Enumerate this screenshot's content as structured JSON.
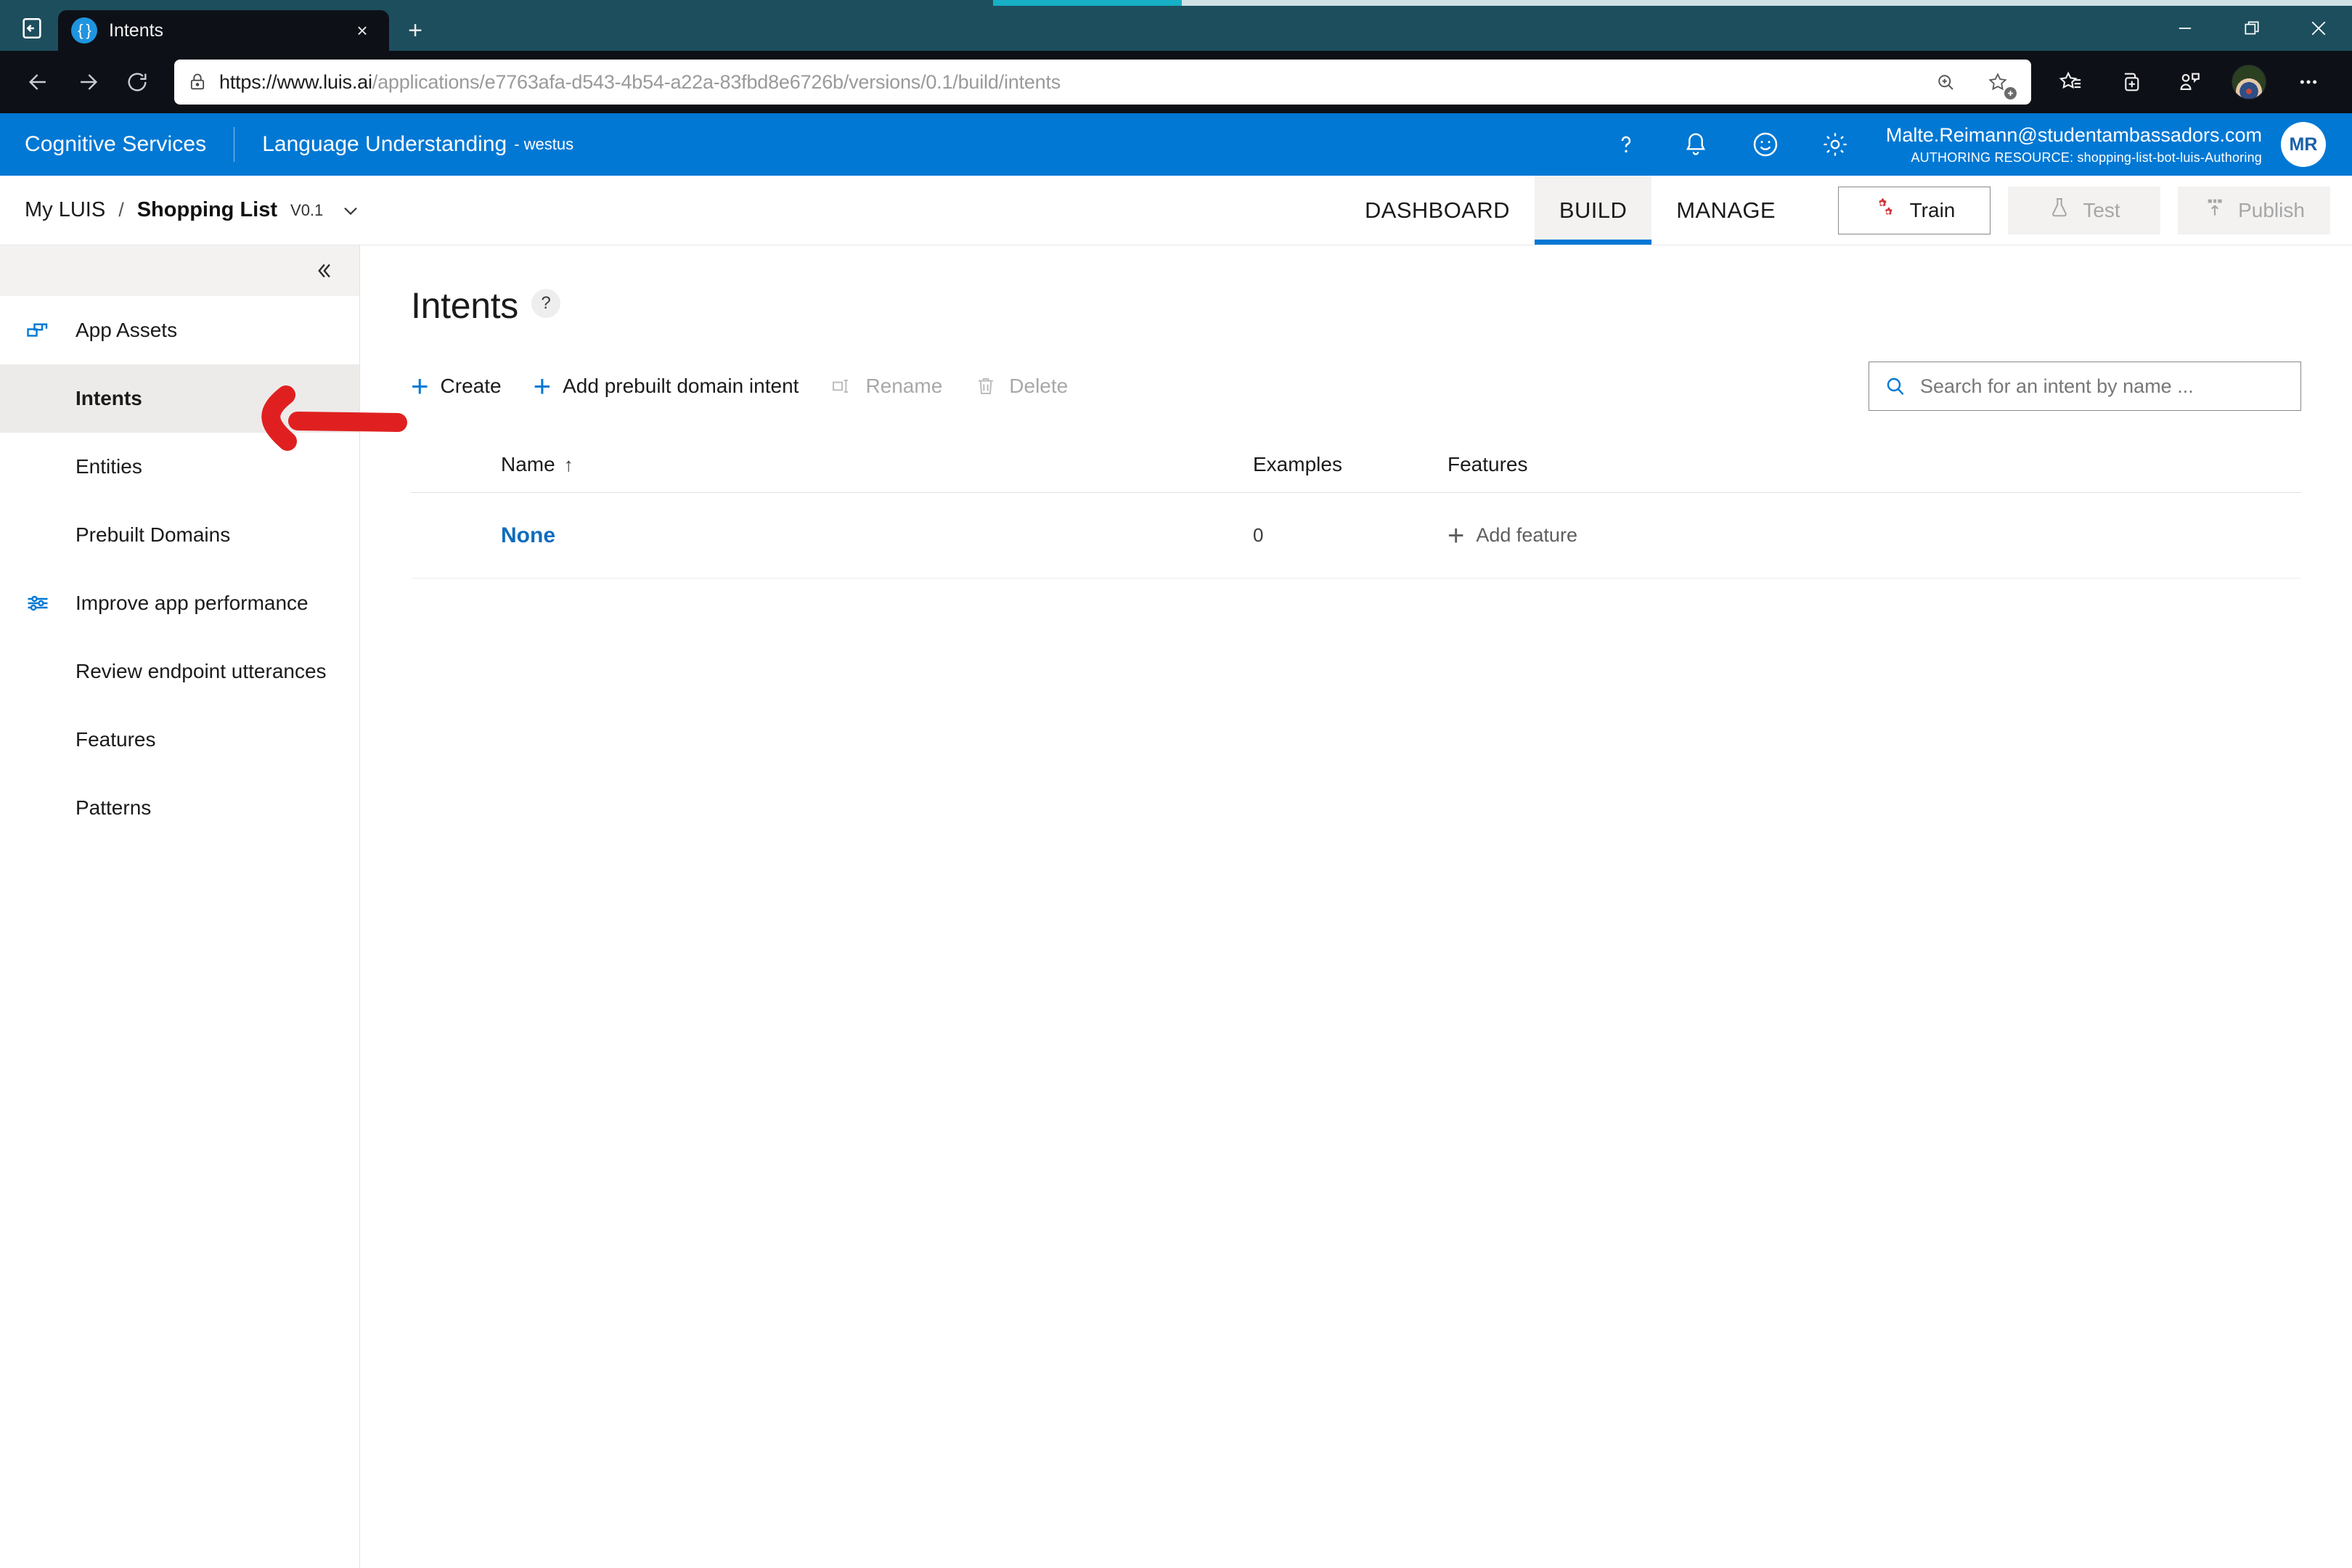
{
  "browser": {
    "tab": {
      "title": "Intents",
      "favicon": "braces-icon",
      "close_label": "×"
    },
    "newtab_label": "+",
    "window_controls": {
      "minimize": "—",
      "restore": "❐",
      "close": "×"
    },
    "nav": {
      "back": "back-arrow-icon",
      "forward": "forward-arrow-icon",
      "reload": "reload-icon"
    },
    "url": {
      "scheme_host": "https://www.luis.ai",
      "path": "/applications/e7763afa-d543-4b54-a22a-83fbd8e6726b/versions/0.1/build/intents"
    },
    "toolbar_icons": [
      "zoom-in-icon",
      "add-favorite-icon",
      "favorites-icon",
      "collections-icon",
      "profile-chat-icon",
      "user-avatar",
      "more-options-icon"
    ]
  },
  "header": {
    "brand": "Cognitive Services",
    "product": "Language Understanding",
    "region": "- westus",
    "icons": [
      "help-icon",
      "notification-bell-icon",
      "feedback-smiley-icon",
      "settings-gear-icon"
    ],
    "user_email": "Malte.Reimann@studentambassadors.com",
    "authoring_resource": "AUTHORING RESOURCE:  shopping-list-bot-luis-Authoring",
    "avatar_initials": "MR",
    "accent_color": "#0078d4"
  },
  "appnav": {
    "breadcrumb_root": "My LUIS",
    "breadcrumb_separator": "/",
    "app_name": "Shopping List",
    "version": "V0.1",
    "tabs": [
      {
        "label": "DASHBOARD",
        "active": false
      },
      {
        "label": "BUILD",
        "active": true
      },
      {
        "label": "MANAGE",
        "active": false
      }
    ],
    "buttons": [
      {
        "label": "Train",
        "state": "enabled",
        "icon": "gears-icon"
      },
      {
        "label": "Test",
        "state": "disabled",
        "icon": "flask-icon"
      },
      {
        "label": "Publish",
        "state": "disabled",
        "icon": "publish-up-icon"
      }
    ]
  },
  "sidebar": {
    "collapse_label": "«",
    "items": [
      {
        "label": "App Assets",
        "icon": "app-assets-icon",
        "type": "group",
        "active": false
      },
      {
        "label": "Intents",
        "icon": null,
        "type": "child",
        "active": true
      },
      {
        "label": "Entities",
        "icon": null,
        "type": "child",
        "active": false
      },
      {
        "label": "Prebuilt Domains",
        "icon": null,
        "type": "child",
        "active": false
      },
      {
        "label": "Improve app performance",
        "icon": "sliders-icon",
        "type": "group",
        "active": false
      },
      {
        "label": "Review endpoint utterances",
        "icon": null,
        "type": "child",
        "active": false
      },
      {
        "label": "Features",
        "icon": null,
        "type": "child",
        "active": false
      },
      {
        "label": "Patterns",
        "icon": null,
        "type": "child",
        "active": false
      }
    ]
  },
  "main": {
    "title": "Intents",
    "help_badge": "?",
    "toolbar": [
      {
        "label": "Create",
        "icon": "plus-icon",
        "state": "enabled"
      },
      {
        "label": "Add prebuilt domain intent",
        "icon": "plus-icon",
        "state": "enabled"
      },
      {
        "label": "Rename",
        "icon": "rename-icon",
        "state": "disabled"
      },
      {
        "label": "Delete",
        "icon": "trash-icon",
        "state": "disabled"
      }
    ],
    "search": {
      "placeholder": "Search for an intent by name ...",
      "value": "",
      "icon": "search-icon"
    },
    "table": {
      "columns": [
        "Name",
        "Examples",
        "Features"
      ],
      "sort_column": "Name",
      "sort_direction": "↑",
      "rows": [
        {
          "name": "None",
          "examples": "0",
          "features_action": "Add feature",
          "features_icon": "plus-icon"
        }
      ]
    }
  },
  "annotation": {
    "type": "red-arrow",
    "color": "#e02020",
    "points_to": "Intents"
  }
}
